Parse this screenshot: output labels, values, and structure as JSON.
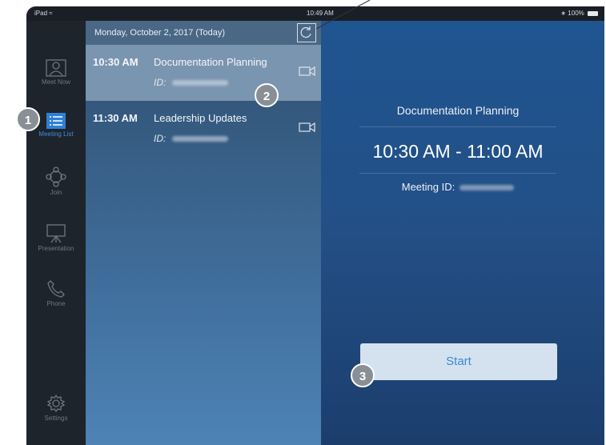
{
  "status_bar": {
    "device": "iPad",
    "wifi_icon": "wifi-icon",
    "time": "10:49 AM",
    "bluetooth_icon": "bluetooth-icon",
    "battery": "100%"
  },
  "rail": {
    "items": [
      {
        "label": "Meet Now",
        "icon": "person-icon"
      },
      {
        "label": "Meeting List",
        "icon": "list-icon",
        "active": true
      },
      {
        "label": "Join",
        "icon": "join-icon"
      },
      {
        "label": "Presentation",
        "icon": "projector-icon"
      },
      {
        "label": "Phone",
        "icon": "phone-icon"
      },
      {
        "label": "Settings",
        "icon": "gear-icon"
      }
    ]
  },
  "list": {
    "date_header": "Monday, October 2, 2017 (Today)",
    "refresh_icon": "refresh-icon",
    "meetings": [
      {
        "time": "10:30 AM",
        "title": "Documentation Planning",
        "id_label": "ID:",
        "selected": true
      },
      {
        "time": "11:30 AM",
        "title": "Leadership Updates",
        "id_label": "ID:",
        "selected": false
      }
    ]
  },
  "detail": {
    "title": "Documentation Planning",
    "time_range": "10:30 AM - 11:00 AM",
    "meeting_id_label": "Meeting ID:",
    "start_label": "Start"
  },
  "callouts": [
    "1",
    "2",
    "3"
  ],
  "colors": {
    "accent": "#3d8de0",
    "start_button_bg": "#d4e2ef",
    "callout_bg": "#8a8f96"
  }
}
